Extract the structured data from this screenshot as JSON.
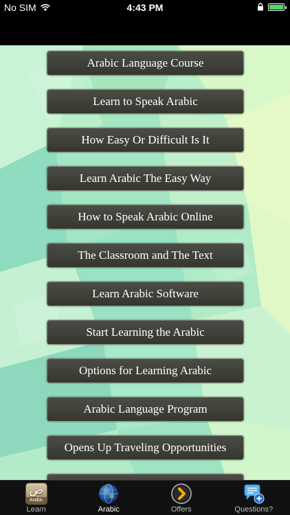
{
  "status_bar": {
    "carrier": "No SIM",
    "time": "4:43 PM",
    "battery_level": 1.0,
    "icons": [
      "wifi-icon",
      "lock-icon",
      "battery-icon"
    ]
  },
  "menu": {
    "items": [
      "Arabic Language Course",
      "Learn to Speak Arabic",
      "How Easy Or Difficult Is It",
      "Learn Arabic The Easy Way",
      "How to Speak Arabic Online",
      "The Classroom and The Text",
      "Learn Arabic Software",
      "Start Learning the Arabic",
      "Options for Learning Arabic",
      "Arabic Language Program",
      "Opens Up Traveling Opportunities",
      ""
    ]
  },
  "tab_bar": {
    "tabs": [
      {
        "label": "Learn",
        "icon": "learn-app-icon",
        "icon_text": "ض",
        "icon_caption": "Arabic",
        "active": false
      },
      {
        "label": "Arabic",
        "icon": "globe-icon",
        "active": true
      },
      {
        "label": "Offers",
        "icon": "chevron-right-circle-icon",
        "active": false
      },
      {
        "label": "Questions?",
        "icon": "chat-bubble-plus-icon",
        "active": false
      }
    ]
  },
  "colors": {
    "status_bar_bg": "#000000",
    "content_bg": "#b6ecc5",
    "button_bg": "#3f413a",
    "tab_bar_bg": "#111111",
    "battery_green": "#4cd964"
  }
}
